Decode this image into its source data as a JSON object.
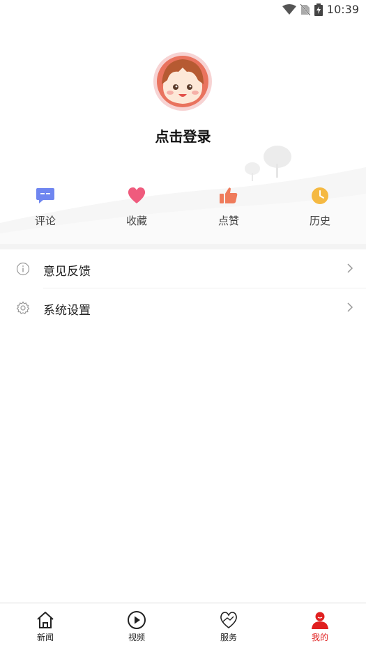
{
  "status_bar": {
    "time": "10:39"
  },
  "profile": {
    "login_text": "点击登录"
  },
  "quick_actions": [
    {
      "label": "评论",
      "icon": "comment-icon",
      "color": "#6f86f0"
    },
    {
      "label": "收藏",
      "icon": "heart-icon",
      "color": "#ef5b7d"
    },
    {
      "label": "点赞",
      "icon": "thumbs-up-icon",
      "color": "#ef7b5b"
    },
    {
      "label": "历史",
      "icon": "clock-icon",
      "color": "#f5b942"
    }
  ],
  "menu": [
    {
      "label": "意见反馈",
      "icon": "info-icon"
    },
    {
      "label": "系统设置",
      "icon": "gear-icon"
    }
  ],
  "tabbar": [
    {
      "label": "新闻",
      "icon": "home-icon",
      "active": false
    },
    {
      "label": "视频",
      "icon": "play-icon",
      "active": false
    },
    {
      "label": "服务",
      "icon": "heart-hand-icon",
      "active": false
    },
    {
      "label": "我的",
      "icon": "user-icon",
      "active": true
    }
  ],
  "colors": {
    "accent": "#e02020",
    "background": "#ffffff"
  }
}
